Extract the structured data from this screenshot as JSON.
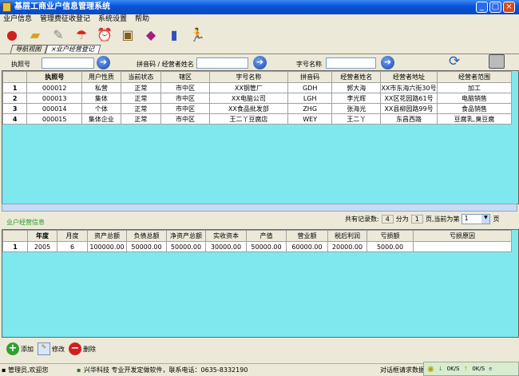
{
  "window": {
    "title": "基层工商业户信息管理系统",
    "controls": [
      "_",
      "□",
      "×"
    ]
  },
  "menu": [
    "业户信息",
    "管理费征收登记",
    "系统设置",
    "帮助"
  ],
  "toolbar": [
    "network-icon",
    "folder-icon",
    "edit-doc-icon",
    "umbrella-icon",
    "alarm-clock-icon",
    "picture-icon",
    "help-book-icon",
    "gift-icon",
    "run-icon"
  ],
  "tabs": [
    "导航视图",
    "×业户经营登记"
  ],
  "search": {
    "license_label": "执照号",
    "license_value": "",
    "pinyin_label": "拼音码 / 经营者姓名",
    "pinyin_value": "",
    "shop_label": "字号名称",
    "shop_value": ""
  },
  "grid1": {
    "headers": [
      "执照号",
      "用户性质",
      "当前状态",
      "辖区",
      "字号名称",
      "拼音码",
      "经营者姓名",
      "经营者地址",
      "经营者范围"
    ],
    "rows": [
      [
        "1",
        "000012",
        "私营",
        "正常",
        "市中区",
        "XX钢管厂",
        "GDH",
        "郭大海",
        "XX市东海六街30号",
        "加工"
      ],
      [
        "2",
        "000013",
        "集体",
        "正常",
        "市中区",
        "XX电脑公司",
        "LGH",
        "李光辉",
        "XX区花园路61号",
        "电脑销售"
      ],
      [
        "3",
        "000014",
        "个体",
        "正常",
        "市中区",
        "XX食品批发部",
        "ZHG",
        "张海光",
        "XX县柳园路99号",
        "食品销售"
      ],
      [
        "4",
        "000015",
        "集体企业",
        "正常",
        "市中区",
        "王二丫豆腐店",
        "WEY",
        "王二丫",
        "东昌西路",
        "豆腐乳,臭豆腐"
      ]
    ]
  },
  "pager": {
    "total_label": "共有记录数:",
    "total": "4",
    "pages_label": "分为",
    "pages": "1",
    "current_label": "页,当前为第",
    "current": "1",
    "suffix": "页"
  },
  "section2_title": "业户经营信息",
  "grid2": {
    "headers": [
      "年度",
      "月度",
      "资产总额",
      "负债总额",
      "净资产总额",
      "实收资本",
      "产值",
      "营业额",
      "税后利润",
      "亏损额",
      "亏损原因"
    ],
    "rows": [
      [
        "1",
        "2005",
        "6",
        "100000.00",
        "50000.00",
        "50000.00",
        "30000.00",
        "50000.00",
        "60000.00",
        "20000.00",
        "5000.00",
        ""
      ]
    ]
  },
  "actions": {
    "add": "添加",
    "edit": "修改",
    "delete": "删除"
  },
  "status": {
    "user": "管理员,欢迎您",
    "company": "兴华科技 专业开发定做软件，联系电话：0635-8332190",
    "dialog": "对话框请求数据",
    "down": "0K/S",
    "up": "0K/S"
  }
}
